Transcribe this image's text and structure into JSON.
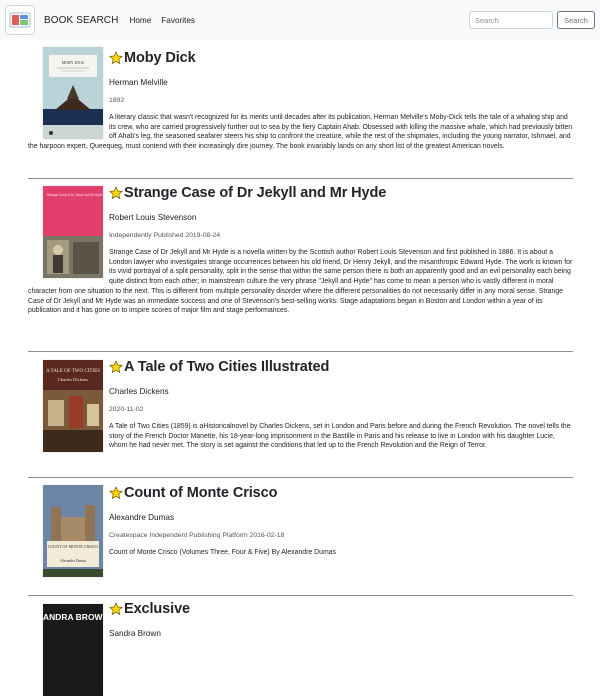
{
  "navbar": {
    "brand": "BOOK SEARCH",
    "links": [
      "Home",
      "Favorites"
    ],
    "search_placeholder": "Search",
    "search_button": "Search"
  },
  "books": [
    {
      "title": "Moby Dick",
      "author": "Herman Melville",
      "meta": "1892",
      "description": "A literary classic that wasn't recognized for its merits until decades after its publication, Herman Melville's Moby-Dick tells the tale of a whaling ship and its crew, who are carried progressively further out to sea by the fiery Captain Ahab. Obsessed with killing the massive whale, which had previously bitten off Ahab's leg, the seasoned seafarer steers his ship to confront the creature, while the rest of the shipmates, including the young narrator, Ishmael, and the harpoon expert, Queequeg, must contend with their increasingly dire journey. The book invariably lands on any short list of the greatest American novels.",
      "cover_title": "MOBY DICK",
      "cover_color": "#b9d3d8"
    },
    {
      "title": "Strange Case of Dr Jekyll and Mr Hyde",
      "author": "Robert Louis Stevenson",
      "meta": "Independently Published 2019-08-24",
      "description": "Strange Case of Dr Jekyll and Mr Hyde is a novella written by the Scottish author Robert Louis Stevenson and first published in 1886. It is about a London lawyer who investigates strange occurrences between his old friend, Dr Henry Jekyll, and the misanthropic Edward Hyde. The work is known for its vivid portrayal of a split personality, split in the sense that within the same person there is both an apparently good and an evil personality each being quite distinct from each other; in mainstream culture the very phrase \"Jekyll and Hyde\" has come to mean a person who is vastly different in moral character from one situation to the next. This is different from multiple personality disorder where the different personalities do not necessarily differ in any moral sense. Strange Case of Dr Jekyll and Mr Hyde was an immediate success and one of Stevenson's best-selling works. Stage adaptations began in Boston and London within a year of its publication and it has gone on to inspire scores of major film and stage performances.",
      "cover_title": "Strange Case of Dr Jekyll and Mr Hyde",
      "cover_color": "#e23f6c"
    },
    {
      "title": "A Tale of Two Cities Illustrated",
      "author": "Charles Dickens",
      "meta": "2020-11-02",
      "description": "A Tale of Two Cities (1859) is aHistoricalnovel by Charles Dickens, set in London and Paris before and during the French Revolution. The novel tells the story of the French Doctor Manette, his 18-year-long imprisonment in the Bastille in Paris and his release to live in London with his daughter Lucie, whom he had never met. The story is set against the conditions that led up to the French Revolution and the Reign of Terror.",
      "cover_title": "A TALE OF TWO CITIES",
      "cover_author": "Charles Dickens",
      "cover_color": "#5a2820"
    },
    {
      "title": "Count of Monte Crisco",
      "author": "Alexandre Dumas",
      "meta": "Createspace Independent Publishing Platform 2016-02-18",
      "description": "Count of Monte Crisco (Volumes Three, Four & Five) By Alexandre Dumas",
      "cover_title": "COUNT OF MONTE CRISCO",
      "cover_author": "Alexandre Dumas",
      "cover_color": "#6e86a6"
    },
    {
      "title": "Exclusive",
      "author": "Sandra Brown",
      "meta": "",
      "description": "",
      "cover_title": "SANDRA BROWN",
      "cover_color": "#1a1a1a"
    }
  ],
  "colors": {
    "navbar_bg": "#f8f9fa",
    "star": "#ffd60a",
    "divider": "#8e8e8e"
  },
  "icons": {
    "favorite": "star-icon",
    "brand": "book-search-logo-icon"
  }
}
